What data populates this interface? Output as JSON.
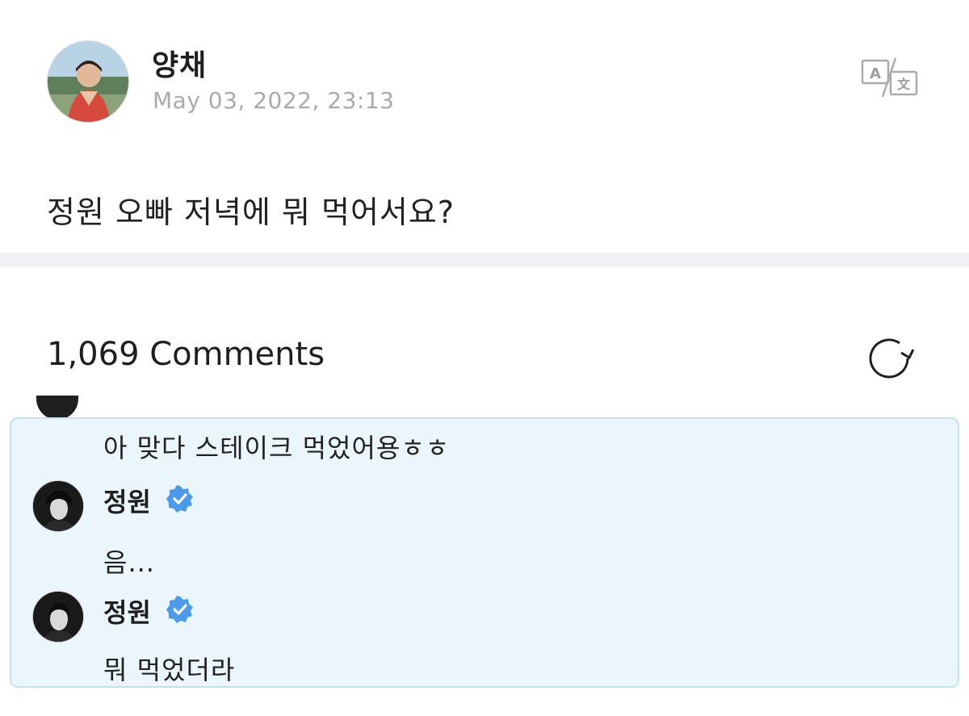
{
  "post": {
    "author_name": "양채",
    "date": "May 03, 2022, 23:13",
    "body": "정원 오빠 저녁에 뭐 먹어서요?",
    "translate_icon": "translate-icon"
  },
  "comments": {
    "count_label": "1,069 Comments",
    "refresh_icon": "refresh-icon",
    "thread": [
      {
        "text": "아 맞다 스테이크 먹었어용ㅎㅎ"
      },
      {
        "name": "정원",
        "verified": true,
        "text": "음..."
      },
      {
        "name": "정원",
        "verified": true,
        "text": "뭐 먹었더라"
      }
    ]
  },
  "colors": {
    "thread_bg": "#eaf6fc",
    "thread_border": "#c5e1ef",
    "verified_blue": "#4b9be8",
    "date_gray": "#a8aab0"
  }
}
